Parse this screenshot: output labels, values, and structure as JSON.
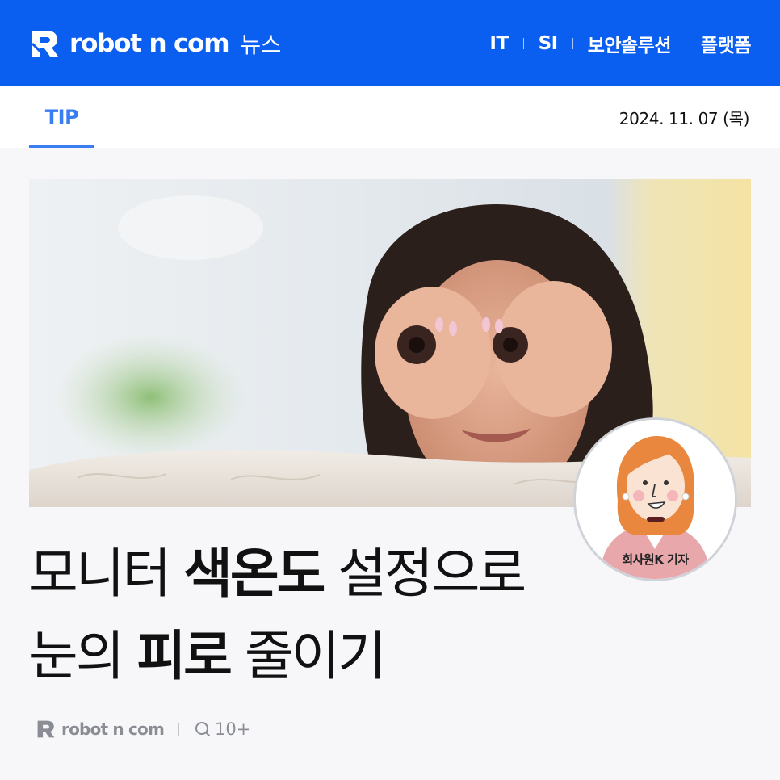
{
  "header": {
    "brand_name": "robot n com",
    "brand_suffix": "뉴스",
    "nav": [
      {
        "label": "IT"
      },
      {
        "label": "SI"
      },
      {
        "label": "보안솔루션"
      },
      {
        "label": "플랫폼"
      }
    ],
    "background_color": "#0a5ef0"
  },
  "subbar": {
    "tab_label": "TIP",
    "date": "2024. 11. 07 (목)",
    "accent_color": "#3a7cf2"
  },
  "reporter": {
    "label": "회사원K 기자",
    "icon": "reporter-avatar-icon"
  },
  "headline": {
    "line1_part1": "모니터 ",
    "line1_part2": "색온도",
    "line1_part3": " 설정으로",
    "line2_part1": "눈의 ",
    "line2_part2": "피로",
    "line2_part3": " 줄이기"
  },
  "footer": {
    "brand_name": "robot n com",
    "comment_icon": "search-comment-icon",
    "comment_count": "10+"
  }
}
